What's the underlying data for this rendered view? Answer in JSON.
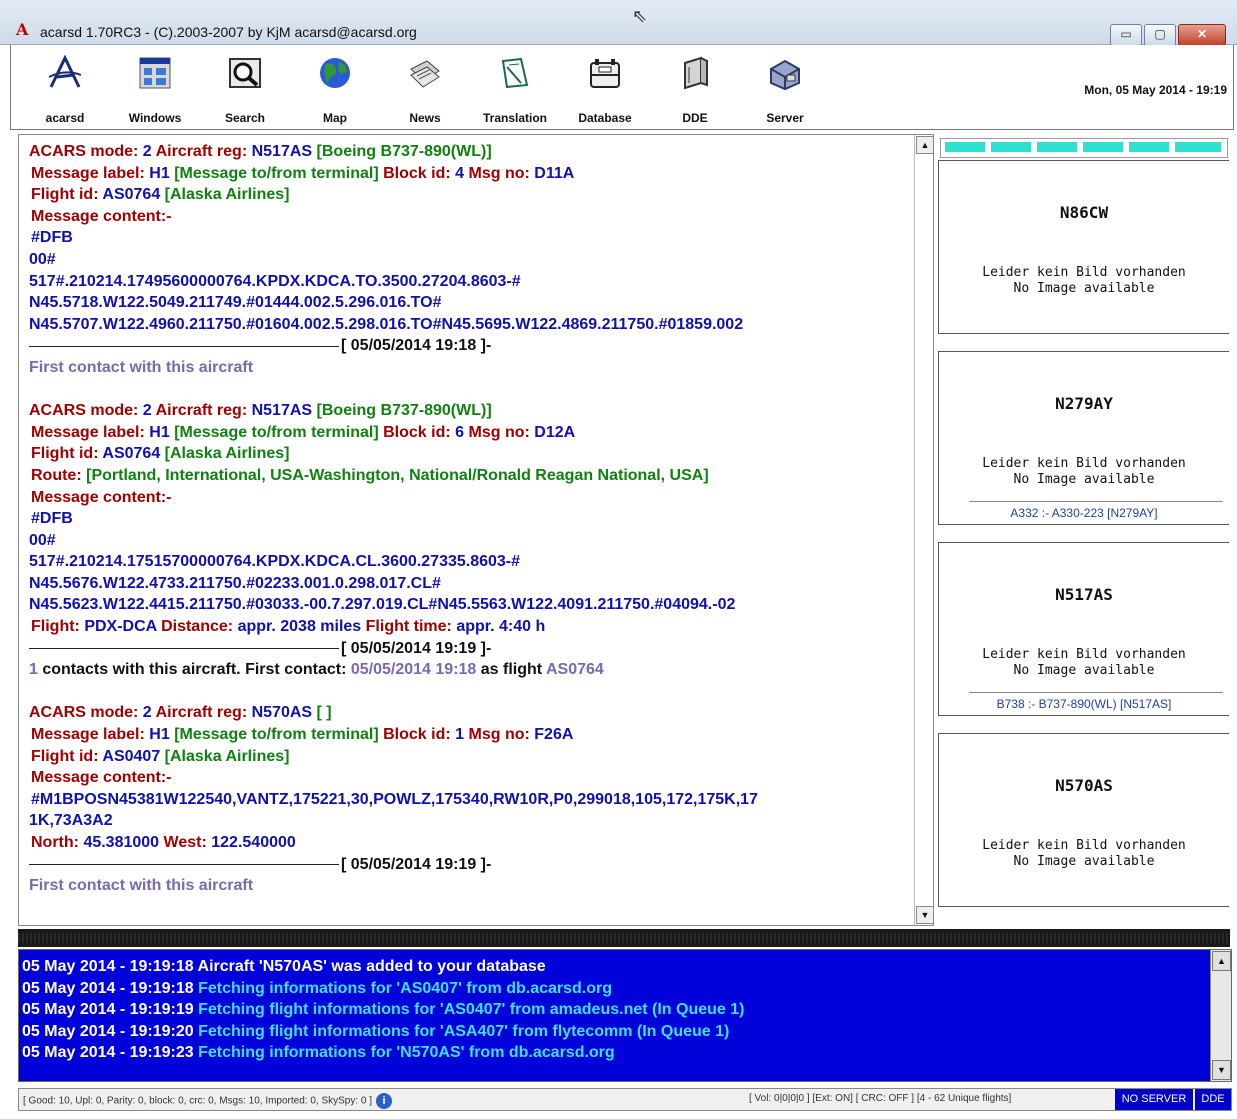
{
  "window": {
    "title": "acarsd 1.70RC3 - (C).2003-2007 by KjM acarsd@acarsd.org",
    "min_glyph": "▭",
    "max_glyph": "▢",
    "close_glyph": "✕"
  },
  "toolbar": {
    "items": [
      {
        "label": "acarsd",
        "icon": "acarsd-logo-icon"
      },
      {
        "label": "Windows",
        "icon": "windows-icon"
      },
      {
        "label": "Search",
        "icon": "search-icon"
      },
      {
        "label": "Map",
        "icon": "globe-icon"
      },
      {
        "label": "News",
        "icon": "newspaper-icon"
      },
      {
        "label": "Translation",
        "icon": "translation-icon"
      },
      {
        "label": "Database",
        "icon": "database-icon"
      },
      {
        "label": "DDE",
        "icon": "dde-icon"
      },
      {
        "label": "Server",
        "icon": "server-icon"
      }
    ],
    "datetime": "Mon, 05 May 2014 - 19:19"
  },
  "messages": {
    "m1": {
      "mode_label": "ACARS mode:",
      "mode": "2",
      "reg_label": "Aircraft reg:",
      "reg": "N517AS",
      "aircraft": "[Boeing B737-890(WL)]",
      "msglabel_label": "Message label:",
      "msglabel": "H1",
      "msglabel_desc": "[Message to/from terminal]",
      "block_label": "Block id:",
      "block": "4",
      "msgno_label": "Msg no:",
      "msgno": "D11A",
      "flight_label": "Flight id:",
      "flight": "AS0764",
      "airline": "[Alaska Airlines]",
      "content_label": "Message content:-",
      "content": [
        "#DFB",
        "00#",
        "517#.210214.17495600000764.KPDX.KDCA.TO.3500.27204.8603-#",
        "N45.5718.W122.5049.211749.#01444.002.5.296.016.TO#",
        "N45.5707.W122.4960.211750.#01604.002.5.298.016.TO#N45.5695.W122.4869.211750.#01859.002"
      ],
      "timestamp": "[ 05/05/2014 19:18 ]-",
      "footer": "First contact with this aircraft"
    },
    "m2": {
      "mode_label": "ACARS mode:",
      "mode": "2",
      "reg_label": "Aircraft reg:",
      "reg": "N517AS",
      "aircraft": "[Boeing B737-890(WL)]",
      "msglabel_label": "Message label:",
      "msglabel": "H1",
      "msglabel_desc": "[Message to/from terminal]",
      "block_label": "Block id:",
      "block": "6",
      "msgno_label": "Msg no:",
      "msgno": "D12A",
      "flight_label": "Flight id:",
      "flight": "AS0764",
      "airline": "[Alaska Airlines]",
      "route_label": "Route:",
      "route": "[Portland, International, USA-Washington, National/Ronald Reagan National, USA]",
      "content_label": "Message content:-",
      "content": [
        "#DFB",
        "00#",
        "517#.210214.17515700000764.KPDX.KDCA.CL.3600.27335.8603-#",
        "N45.5676.W122.4733.211750.#02233.001.0.298.017.CL#",
        "N45.5623.W122.4415.211750.#03033.-00.7.297.019.CL#N45.5563.W122.4091.211750.#04094.-02"
      ],
      "flightinfo_label": "Flight:",
      "flightinfo": "PDX-DCA",
      "distance_label": "Distance:",
      "distance": "appr. 2038 miles",
      "ftime_label": "Flight time:",
      "ftime": "appr. 4:40 h",
      "timestamp": "[ 05/05/2014 19:19 ]-",
      "contacts_count": "1",
      "contacts_text": "contacts with this aircraft. First contact:",
      "first_contact": "05/05/2014 19:18",
      "as_flight": "as flight",
      "first_flight": "AS0764"
    },
    "m3": {
      "mode_label": "ACARS mode:",
      "mode": "2",
      "reg_label": "Aircraft reg:",
      "reg": "N570AS",
      "aircraft": "[ ]",
      "msglabel_label": "Message label:",
      "msglabel": "H1",
      "msglabel_desc": "[Message to/from terminal]",
      "block_label": "Block id:",
      "block": "1",
      "msgno_label": "Msg no:",
      "msgno": "F26A",
      "flight_label": "Flight id:",
      "flight": "AS0407",
      "airline": "[Alaska Airlines]",
      "content_label": "Message content:-",
      "content": [
        "#M1BPOSN45381W122540,VANTZ,175221,30,POWLZ,175340,RW10R,P0,299018,105,172,175K,17",
        "1K,73A3A2"
      ],
      "north_label": "North:",
      "north": "45.381000",
      "west_label": "West:",
      "west": "122.540000",
      "timestamp": "[ 05/05/2014 19:19 ]-",
      "footer": "First contact with this aircraft"
    }
  },
  "aircraft_cards": [
    {
      "reg": "N86CW",
      "noimg_de": "Leider kein Bild vorhanden",
      "noimg_en": "No Image available",
      "type": ""
    },
    {
      "reg": "N279AY",
      "noimg_de": "Leider kein Bild vorhanden",
      "noimg_en": "No Image available",
      "type": "A332 :- A330-223 [N279AY]"
    },
    {
      "reg": "N517AS",
      "noimg_de": "Leider kein Bild vorhanden",
      "noimg_en": "No Image available",
      "type": "B738 :- B737-890(WL) [N517AS]"
    },
    {
      "reg": "N570AS",
      "noimg_de": "Leider kein Bild vorhanden",
      "noimg_en": "No Image available",
      "type": ""
    }
  ],
  "log": [
    {
      "ts": "05 May 2014 - 19:19:18",
      "text": "Aircraft 'N570AS' was added to your database",
      "color": "white"
    },
    {
      "ts": "05 May 2014 - 19:19:18",
      "text": "Fetching informations for 'AS0407' from db.acarsd.org",
      "color": "cyan"
    },
    {
      "ts": "05 May 2014 - 19:19:19",
      "text": "Fetching flight informations for 'AS0407' from amadeus.net (In Queue 1)",
      "color": "cyan"
    },
    {
      "ts": "05 May 2014 - 19:19:20",
      "text": "Fetching flight informations for 'ASA407' from flytecomm (In Queue 1)",
      "color": "cyan"
    },
    {
      "ts": "05 May 2014 - 19:19:23",
      "text": "Fetching informations for 'N570AS' from db.acarsd.org",
      "color": "cyan"
    }
  ],
  "statusbar": {
    "left": "[ Good: 10, Upl: 0, Parity: 0, block: 0, crc: 0, Msgs: 10, Imported: 0, SkySpy: 0 ]",
    "info": "i",
    "right": "[ Vol: 0|0|0|0 ]  [Ext: ON]  [ CRC: OFF ]  [4 - 62 Unique flights]",
    "noserver": "NO SERVER",
    "dde": "DDE"
  },
  "scroll": {
    "up": "▲",
    "down": "▼"
  },
  "colors": {
    "log_bg": "#0000d8",
    "log_cyan": "#3ee0ff",
    "progress": "#2fe0d0",
    "msg_red": "#a00000",
    "msg_blue": "#1010b0",
    "msg_green": "#108010"
  }
}
